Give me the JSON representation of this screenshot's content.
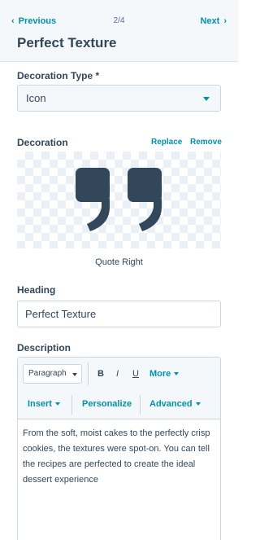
{
  "header": {
    "prev_label": "Previous",
    "prev_icon": "chevron-left-icon",
    "next_label": "Next",
    "next_icon": "chevron-right-icon",
    "page_indicator": "2/4",
    "title": "Perfect Texture"
  },
  "decoration_type": {
    "label": "Decoration Type *",
    "value": "Icon"
  },
  "decoration": {
    "label": "Decoration",
    "replace_label": "Replace",
    "remove_label": "Remove",
    "icon": "quote-right-icon",
    "icon_color": "#33475b",
    "caption": "Quote Right"
  },
  "heading": {
    "label": "Heading",
    "value": "Perfect Texture"
  },
  "description": {
    "label": "Description",
    "toolbar": {
      "paragraph": "Paragraph",
      "bold": "B",
      "italic": "I",
      "underline": "U",
      "more": "More",
      "insert": "Insert",
      "personalize": "Personalize",
      "advanced": "Advanced"
    },
    "text": "From the soft, moist cakes to the perfectly crisp cookies, the textures were spot-on. You can tell the recipes are perfected to create the ideal dessert experience"
  },
  "colors": {
    "accent": "#0091ae",
    "text": "#33475b",
    "border": "#cbd6e2",
    "panel": "#f5f8fa"
  }
}
